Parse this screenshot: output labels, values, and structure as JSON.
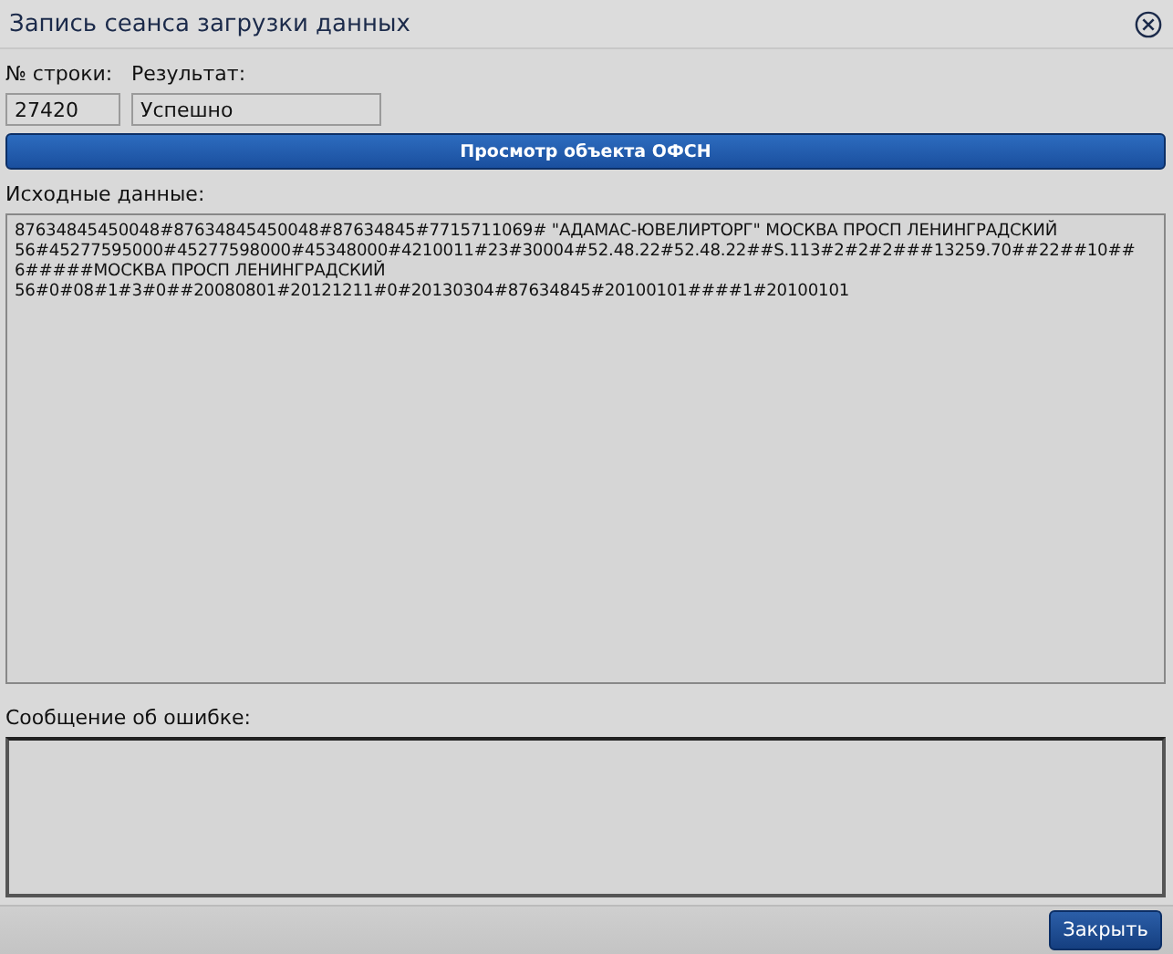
{
  "window": {
    "title": "Запись сеанса загрузки данных"
  },
  "fields": [
    {
      "label": "№ строки:",
      "value": "27420"
    },
    {
      "label": "Результат:",
      "value": "Успешно"
    }
  ],
  "view_button": "Просмотр объекта ОФСН",
  "source": {
    "label": "Исходные данные:",
    "value": "87634845450048#87634845450048#87634845#7715711069# \"АДАМАС-ЮВЕЛИРТОРГ\" МОСКВА ПРОСП ЛЕНИНГРАДСКИЙ\n56#45277595000#45277598000#45348000#4210011#23#30004#52.48.22#52.48.22##S.113#2#2#2###13259.70##22##10##\n6#####МОСКВА ПРОСП ЛЕНИНГРАДСКИЙ\n56#0#08#1#3#0##20080801#20121211#0#20130304#87634845#20100101####1#20100101"
  },
  "error": {
    "label": "Сообщение об ошибке:"
  },
  "close_button": "Закрыть"
}
